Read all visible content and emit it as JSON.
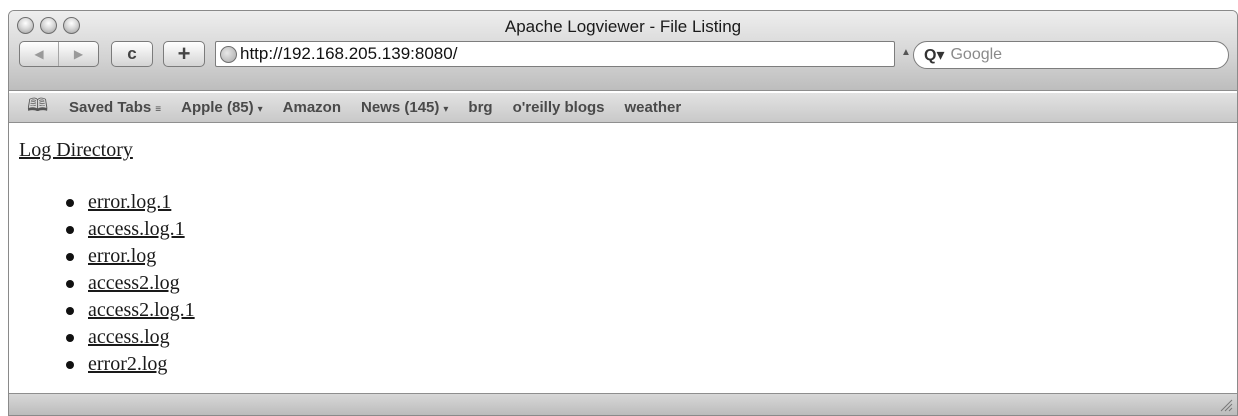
{
  "window": {
    "title": "Apache Logviewer - File Listing"
  },
  "toolbar": {
    "back_icon": "back-arrow-icon",
    "forward_icon": "forward-arrow-icon",
    "reload_glyph": "c",
    "add_glyph": "+",
    "url": "http://192.168.205.139:8080/",
    "search_placeholder": "Google"
  },
  "bookmarks": {
    "icon": "bookmarks-book-icon",
    "items": [
      {
        "label": "Saved Tabs",
        "indicator": "≡"
      },
      {
        "label": "Apple (85)",
        "indicator": "▾"
      },
      {
        "label": "Amazon",
        "indicator": ""
      },
      {
        "label": "News (145)",
        "indicator": "▾"
      },
      {
        "label": "brg",
        "indicator": ""
      },
      {
        "label": "o'reilly blogs",
        "indicator": ""
      },
      {
        "label": "weather",
        "indicator": ""
      }
    ]
  },
  "content": {
    "heading_link": "Log Directory",
    "files": [
      "error.log.1",
      "access.log.1",
      "error.log",
      "access2.log",
      "access2.log.1",
      "access.log",
      "error2.log"
    ]
  }
}
